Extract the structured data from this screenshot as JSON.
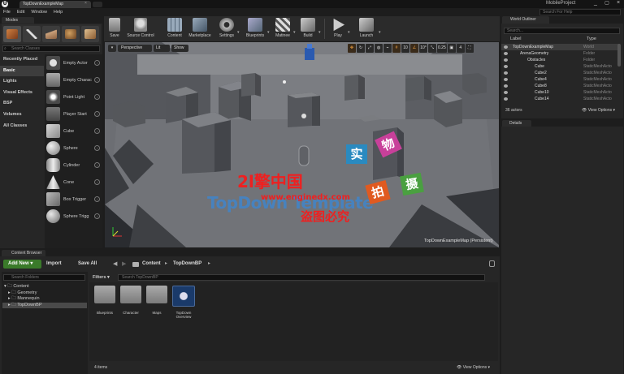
{
  "window": {
    "doc_tab": "TopDownExampleMap",
    "project_name": "MobileProject",
    "help_placeholder": "Search For Help",
    "min": "_",
    "max": "▢",
    "close": "×"
  },
  "menu": [
    "File",
    "Edit",
    "Window",
    "Help"
  ],
  "modes": {
    "tab": "Modes",
    "search_placeholder": "Search Classes",
    "categories": [
      "Recently Placed",
      "Basic",
      "Lights",
      "Visual Effects",
      "BSP",
      "Volumes",
      "All Classes"
    ],
    "active_category": "Basic",
    "items": [
      "Empty Actor",
      "Empty Charac",
      "Point Light",
      "Player Start",
      "Cube",
      "Sphere",
      "Cylinder",
      "Cone",
      "Box Trigger",
      "Sphere Trigg"
    ]
  },
  "toolbar": {
    "buttons": [
      "Save",
      "Source Control",
      "Content",
      "Marketplace",
      "Settings",
      "Blueprints",
      "Matinee",
      "Build",
      "Play",
      "Launch"
    ]
  },
  "viewport": {
    "menu": "▾",
    "perspective": "Perspective",
    "lit": "Lit",
    "show": "Show",
    "snap_grid": "10",
    "snap_rot": "10°",
    "snap_scale": "0.25",
    "cam_speed": "4",
    "map_label": "TopDownExampleMap (Persistent)",
    "watermark": {
      "en": "TopDown Template",
      "cn1": "2l擎中国",
      "url": "www.enginedx.com",
      "cn2": "盗图必究",
      "boxes": [
        "实",
        "物",
        "拍",
        "摄"
      ]
    }
  },
  "outliner": {
    "tab": "World Outliner",
    "search_placeholder": "Search...",
    "col_label": "Label",
    "col_type": "Type",
    "rows": [
      {
        "label": "TopDownExampleMap",
        "type": "World",
        "indent": 0
      },
      {
        "label": "ArenaGeometry",
        "type": "Folder",
        "indent": 1
      },
      {
        "label": "Obstacles",
        "type": "Folder",
        "indent": 2
      },
      {
        "label": "Cube",
        "type": "StaticMeshActo",
        "indent": 3
      },
      {
        "label": "Cube2",
        "type": "StaticMeshActo",
        "indent": 3
      },
      {
        "label": "Cube4",
        "type": "StaticMeshActo",
        "indent": 3
      },
      {
        "label": "Cube8",
        "type": "StaticMeshActo",
        "indent": 3
      },
      {
        "label": "Cube10",
        "type": "StaticMeshActo",
        "indent": 3
      },
      {
        "label": "Cube14",
        "type": "StaticMeshActo",
        "indent": 3
      }
    ],
    "actors": "36 actors",
    "view_options": "👁 View Options ▾"
  },
  "details": {
    "tab": "Details"
  },
  "content_browser": {
    "tab": "Content Browser",
    "add_new": "Add New ▾",
    "import": "Import",
    "save_all": "Save All",
    "crumb_root": "Content",
    "crumb_sep": "▸",
    "crumb_folder": "TopDownBP",
    "search_folders": "Search Folders",
    "tree": [
      "Content",
      "Geometry",
      "Mannequin",
      "TopDownBP"
    ],
    "filters": "Filters ▾",
    "search_assets": "Search TopDownBP",
    "assets": [
      "Blueprints",
      "Character",
      "Maps",
      "TopDown Overview"
    ],
    "items": "4 items",
    "view_options": "👁 View Options ▾"
  },
  "colors": {
    "accent_green": "#3a7a2a",
    "selection": "#3d3d3d",
    "viewport_floor": "#6b6d72"
  }
}
